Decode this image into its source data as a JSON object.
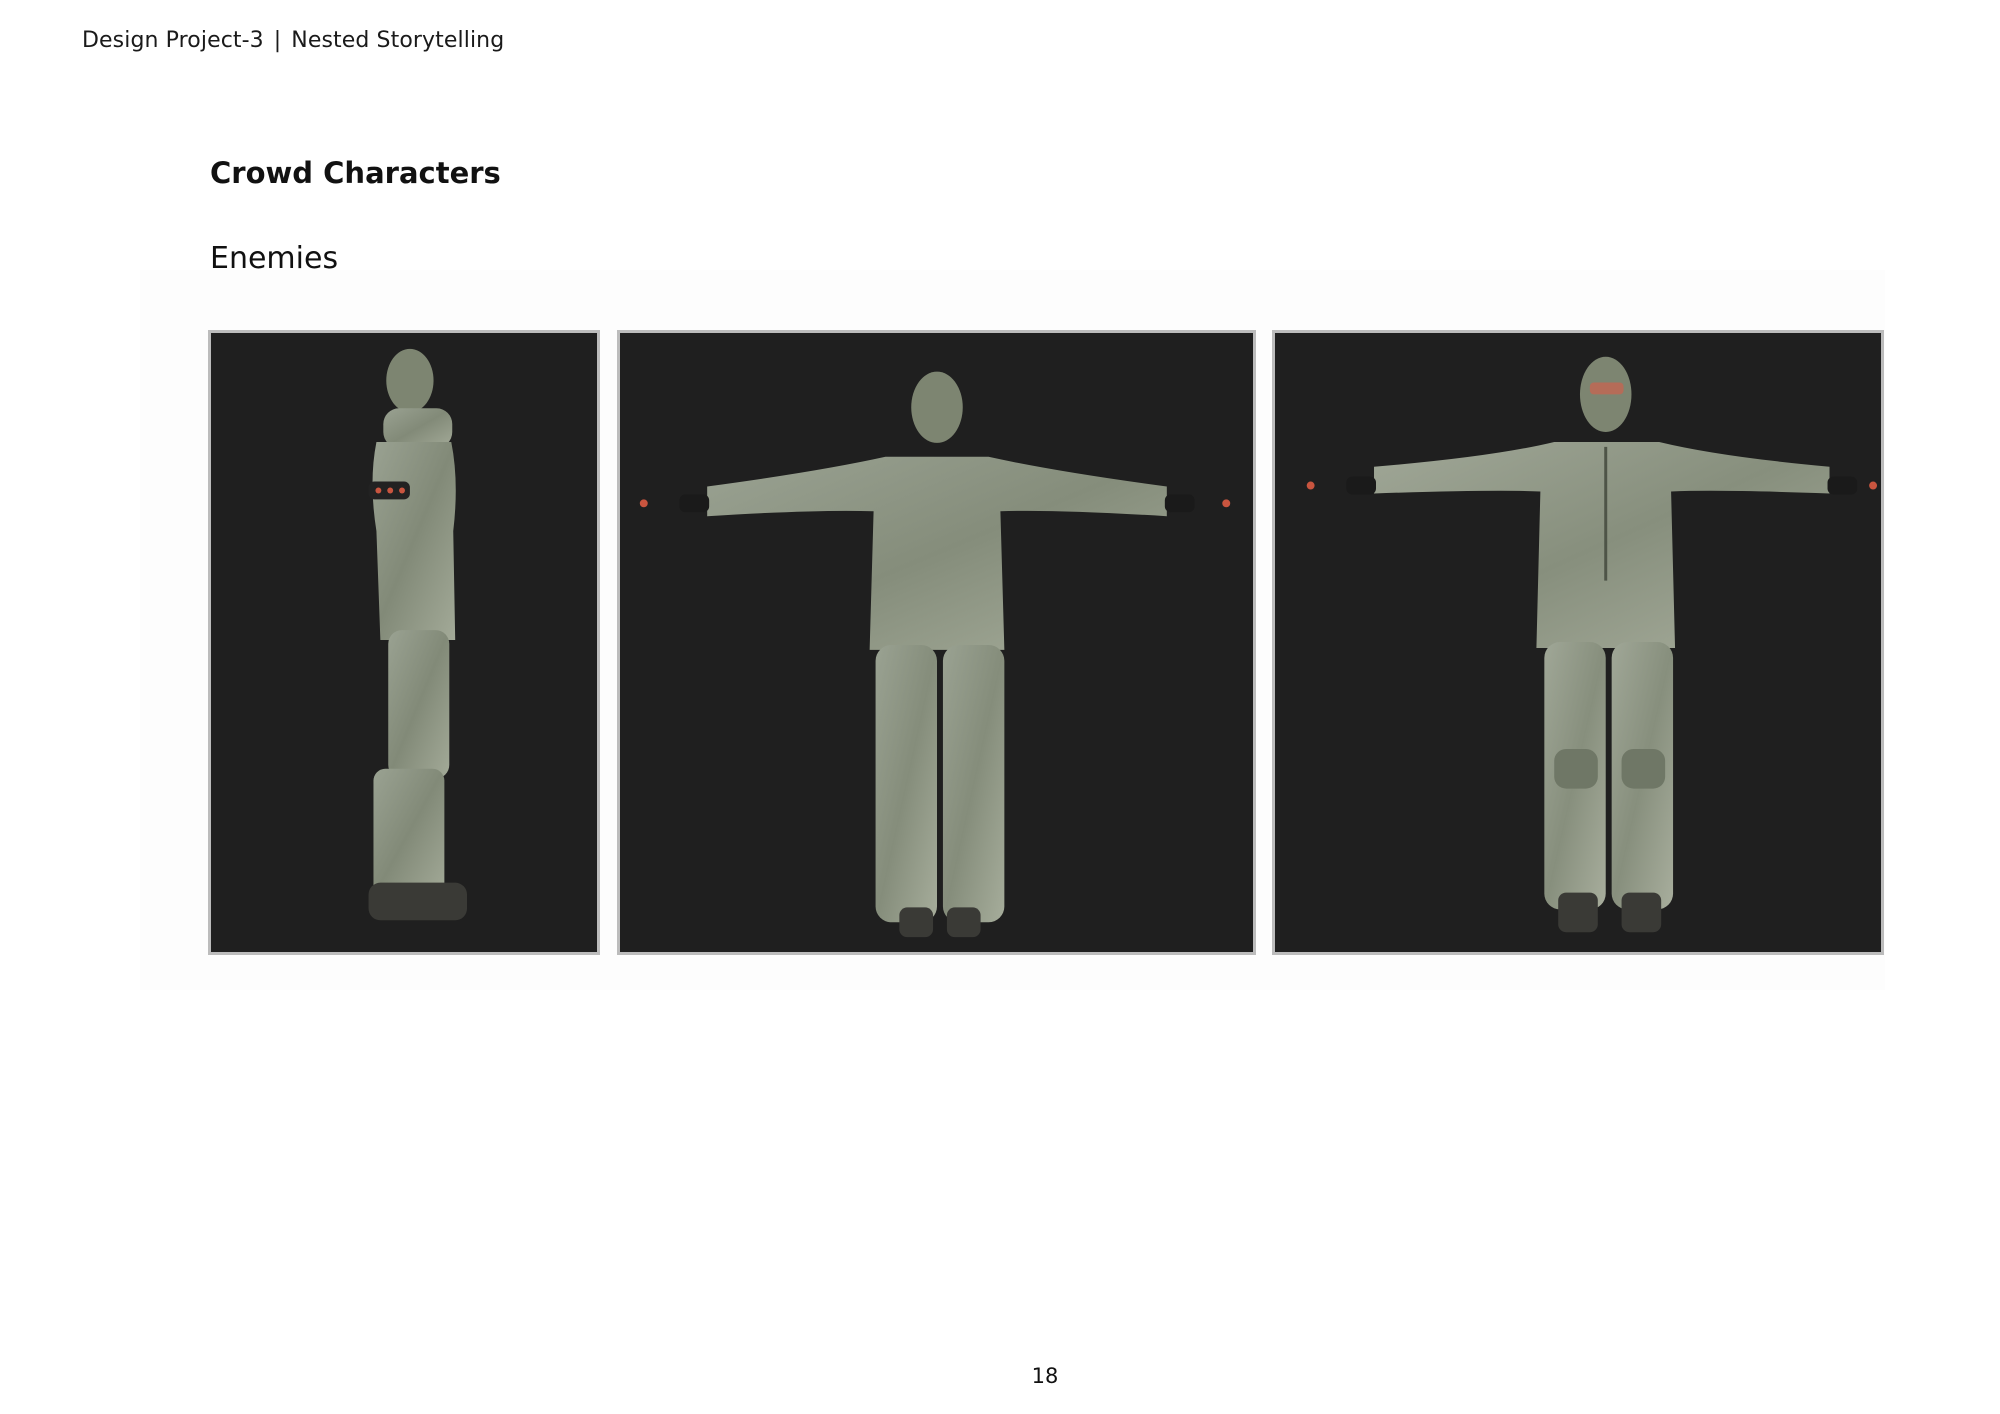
{
  "header": {
    "project": "Design Project-3",
    "separator": "|",
    "subtitle": "Nested Storytelling"
  },
  "section": {
    "title": "Crowd Characters",
    "subtitle": "Enemies"
  },
  "figures": [
    {
      "view": "side",
      "icon": "character-model-side-view"
    },
    {
      "view": "back",
      "icon": "character-model-back-view"
    },
    {
      "view": "front",
      "icon": "character-model-front-view"
    }
  ],
  "colors": {
    "panel_background": "#1f1f1f",
    "camouflage": "#8f9785",
    "panel_border": "#bcbcbc"
  },
  "footer": {
    "page_number": "18"
  }
}
